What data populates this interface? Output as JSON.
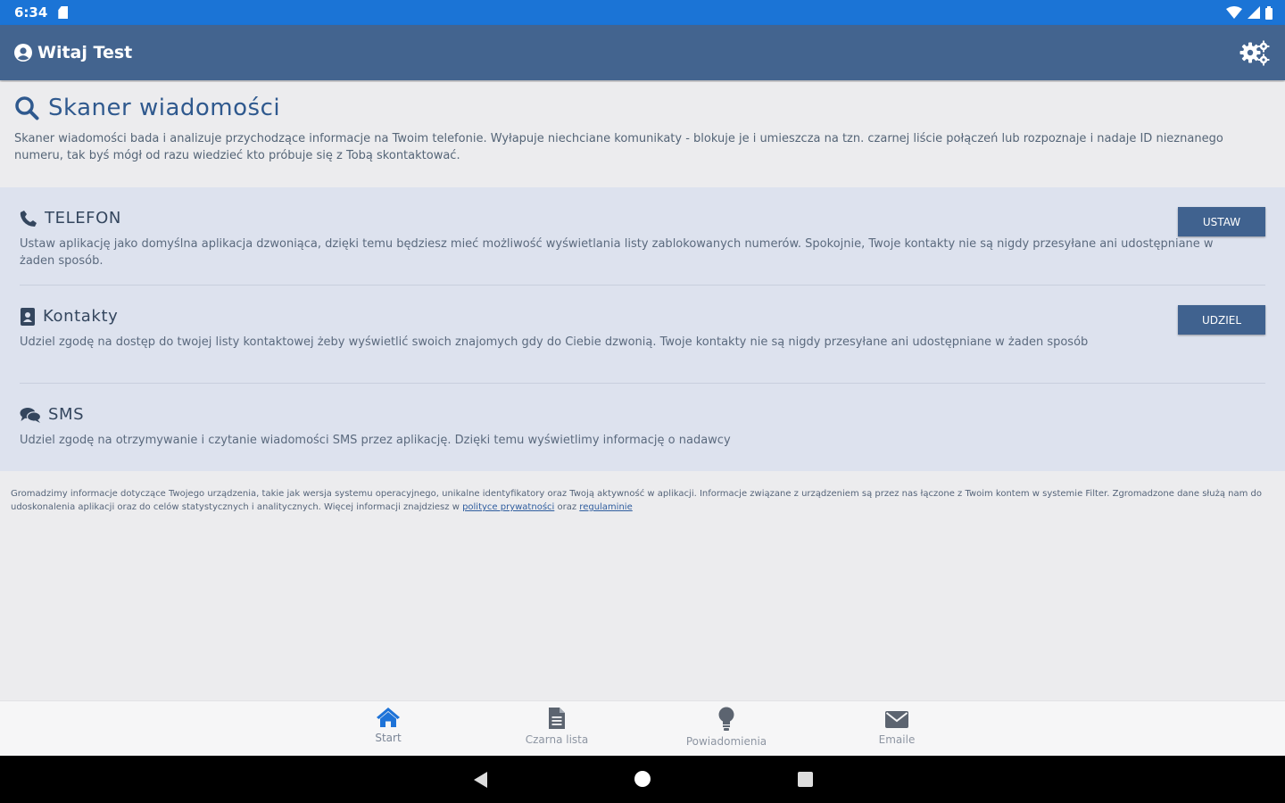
{
  "status_bar": {
    "time": "6:34"
  },
  "app_bar": {
    "greeting": "Witaj Test"
  },
  "intro": {
    "title": "Skaner wiadomości",
    "description": "Skaner wiadomości bada i analizuje przychodzące informacje na Twoim telefonie. Wyłapuje niechciane komunikaty - blokuje je i umieszcza na tzn. czarnej liście połączeń lub rozpoznaje i nadaje ID nieznanego numeru, tak byś mógł od razu wiedzieć kto próbuje się z Tobą skontaktować."
  },
  "permissions": [
    {
      "title": "TELEFON",
      "description": "Ustaw aplikację jako domyślna aplikacja dzwoniąca, dzięki temu będziesz mieć możliwość wyświetlania listy zablokowanych numerów. Spokojnie, Twoje kontakty nie są nigdy przesyłane ani udostępniane w żaden sposób.",
      "button": "USTAW"
    },
    {
      "title": "Kontakty",
      "description": "Udziel zgodę na dostęp do twojej listy kontaktowej żeby wyświetlić swoich znajomych gdy do Ciebie dzwonią. Twoje kontakty nie są nigdy przesyłane ani udostępniane w żaden sposób",
      "button": "UDZIEL"
    },
    {
      "title": "SMS",
      "description": "Udziel zgodę na otrzymywanie i czytanie wiadomości SMS przez aplikację. Dzięki temu wyświetlimy informację o nadawcy"
    }
  ],
  "disclaimer": {
    "text": "Gromadzimy informacje dotyczące Twojego urządzenia, takie jak wersja systemu operacyjnego, unikalne identyfikatory oraz Twoją aktywność w aplikacji. Informacje związane z urządzeniem są przez nas łączone z Twoim kontem w systemie Filter. Zgromadzone dane służą nam do udoskonalenia aplikacji oraz do celów statystycznych i analitycznych. Więcej informacji znajdziesz w",
    "privacy_link": "polityce prywatności",
    "conjunction": "oraz",
    "terms_link": "regulaminie"
  },
  "bottom_nav": [
    {
      "label": "Start",
      "icon": "home-icon",
      "active": true
    },
    {
      "label": "Czarna lista",
      "icon": "document-icon",
      "active": false
    },
    {
      "label": "Powiadomienia",
      "icon": "lightbulb-icon",
      "active": false
    },
    {
      "label": "Emaile",
      "icon": "envelope-icon",
      "active": false
    }
  ],
  "colors": {
    "status_bar": "#1b74d6",
    "app_bar": "#43648f",
    "accent": "#2f598e",
    "button": "#40628f",
    "active_nav_icon": "#1e73d8"
  }
}
